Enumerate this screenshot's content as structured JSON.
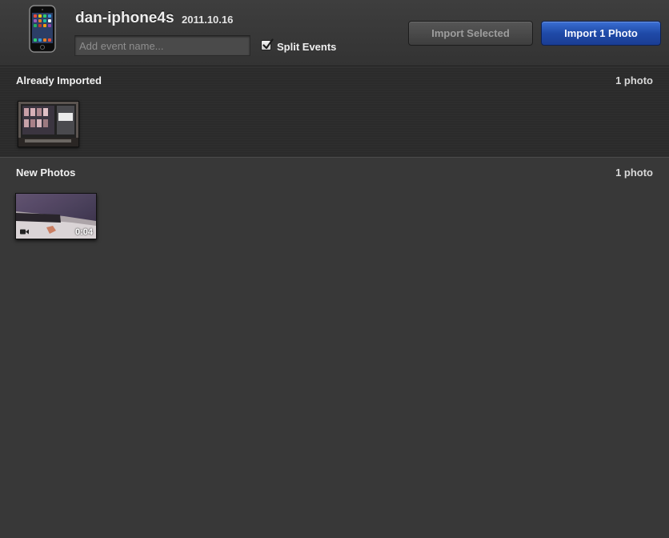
{
  "header": {
    "device_name": "dan-iphone4s",
    "date": "2011.10.16",
    "event_name_placeholder": "Add event name...",
    "event_name_value": "",
    "split_events_label": "Split Events",
    "split_events_checked": true,
    "import_selected_label": "Import Selected",
    "import_photo_label": "Import 1 Photo"
  },
  "sections": {
    "already_imported": {
      "title": "Already Imported",
      "count": "1 photo"
    },
    "new_photos": {
      "title": "New Photos",
      "count": "1 photo",
      "items": [
        {
          "type": "video",
          "duration": "0:04"
        }
      ]
    }
  },
  "icons": {
    "device": "iphone-icon",
    "checkbox": "checkmark-icon",
    "video": "video-camera-icon"
  },
  "colors": {
    "primary_button": "#1f4aa8",
    "background": "#383838",
    "imported_section_bg": "#2b2b2b"
  }
}
